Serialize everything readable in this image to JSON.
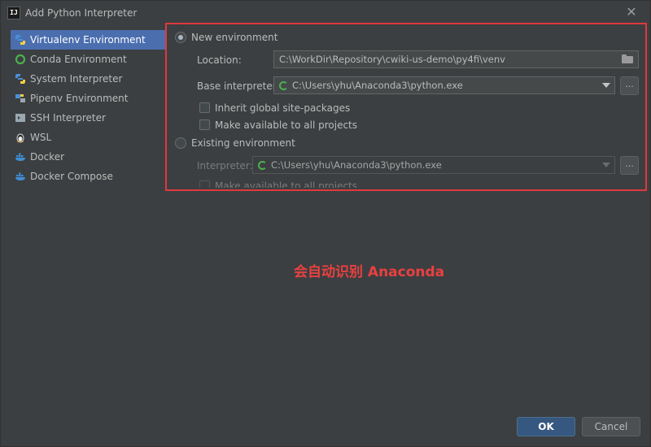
{
  "window": {
    "title": "Add Python Interpreter",
    "app_icon_text": "IJ"
  },
  "sidebar": {
    "items": [
      {
        "label": "Virtualenv Environment",
        "icon": "virtualenv-icon",
        "selected": true
      },
      {
        "label": "Conda Environment",
        "icon": "conda-icon",
        "selected": false
      },
      {
        "label": "System Interpreter",
        "icon": "python-icon",
        "selected": false
      },
      {
        "label": "Pipenv Environment",
        "icon": "pipenv-icon",
        "selected": false
      },
      {
        "label": "SSH Interpreter",
        "icon": "ssh-icon",
        "selected": false
      },
      {
        "label": "WSL",
        "icon": "linux-icon",
        "selected": false
      },
      {
        "label": "Docker",
        "icon": "docker-icon",
        "selected": false
      },
      {
        "label": "Docker Compose",
        "icon": "docker-compose-icon",
        "selected": false
      }
    ]
  },
  "new_env": {
    "radio_label": "New environment",
    "location_label": "Location:",
    "location_value": "C:\\WorkDir\\Repository\\cwiki-us-demo\\py4fi\\venv",
    "base_label": "Base interpreter:",
    "base_value": "C:\\Users\\yhu\\Anaconda3\\python.exe",
    "inherit_label": "Inherit global site-packages",
    "make_available_label": "Make available to all projects"
  },
  "existing_env": {
    "radio_label": "Existing environment",
    "interpreter_label": "Interpreter:",
    "interpreter_value": "C:\\Users\\yhu\\Anaconda3\\python.exe",
    "make_available_label": "Make available to all projects"
  },
  "browse_label": "...",
  "annotation": "会自动识别 Anaconda",
  "buttons": {
    "ok": "OK",
    "cancel": "Cancel"
  },
  "colors": {
    "accent_selected": "#4b6eaf",
    "highlight_box": "#e0383e",
    "annotation": "#e94040",
    "spinner": "#4caf50"
  }
}
